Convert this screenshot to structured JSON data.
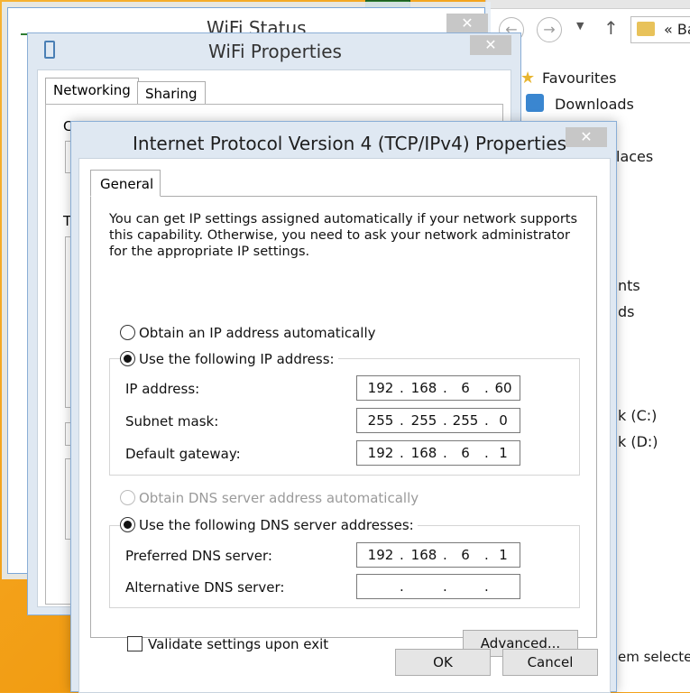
{
  "explorer": {
    "address_text": "« Ba",
    "nav": [
      "Favourites",
      "Downloads",
      "laces",
      "nts",
      "ds",
      "k (C:)",
      "k (D:)"
    ],
    "status_text": "em selected"
  },
  "status_window": {
    "title": "WiFi Status",
    "close_glyph": "✕"
  },
  "props_window": {
    "title": "WiFi Properties",
    "close_glyph": "✕",
    "tabs": [
      "Networking",
      "Sharing"
    ],
    "partial_label_1": "C",
    "partial_label_2": "T"
  },
  "ipv4_dialog": {
    "title": "Internet Protocol Version 4 (TCP/IPv4) Properties",
    "close_glyph": "✕",
    "tab_general": "General",
    "description": "You can get IP settings assigned automatically if your network supports this capability. Otherwise, you need to ask your network administrator for the appropriate IP settings.",
    "ip_auto_label": "Obtain an IP address automatically",
    "ip_manual_label": "Use the following IP address:",
    "ip_mode": "manual",
    "ip_address_label": "IP address:",
    "ip_address": [
      "192",
      "168",
      "6",
      "60"
    ],
    "subnet_mask_label": "Subnet mask:",
    "subnet_mask": [
      "255",
      "255",
      "255",
      "0"
    ],
    "gateway_label": "Default gateway:",
    "gateway": [
      "192",
      "168",
      "6",
      "1"
    ],
    "dns_auto_label": "Obtain DNS server address automatically",
    "dns_manual_label": "Use the following DNS server addresses:",
    "dns_mode": "manual",
    "preferred_dns_label": "Preferred DNS server:",
    "preferred_dns": [
      "192",
      "168",
      "6",
      "1"
    ],
    "alternate_dns_label": "Alternative DNS server:",
    "alternate_dns": [
      "",
      "",
      "",
      ""
    ],
    "validate_label": "Validate settings upon exit",
    "validate_checked": false,
    "advanced_button": "Advanced...",
    "ok_button": "OK",
    "cancel_button": "Cancel"
  }
}
